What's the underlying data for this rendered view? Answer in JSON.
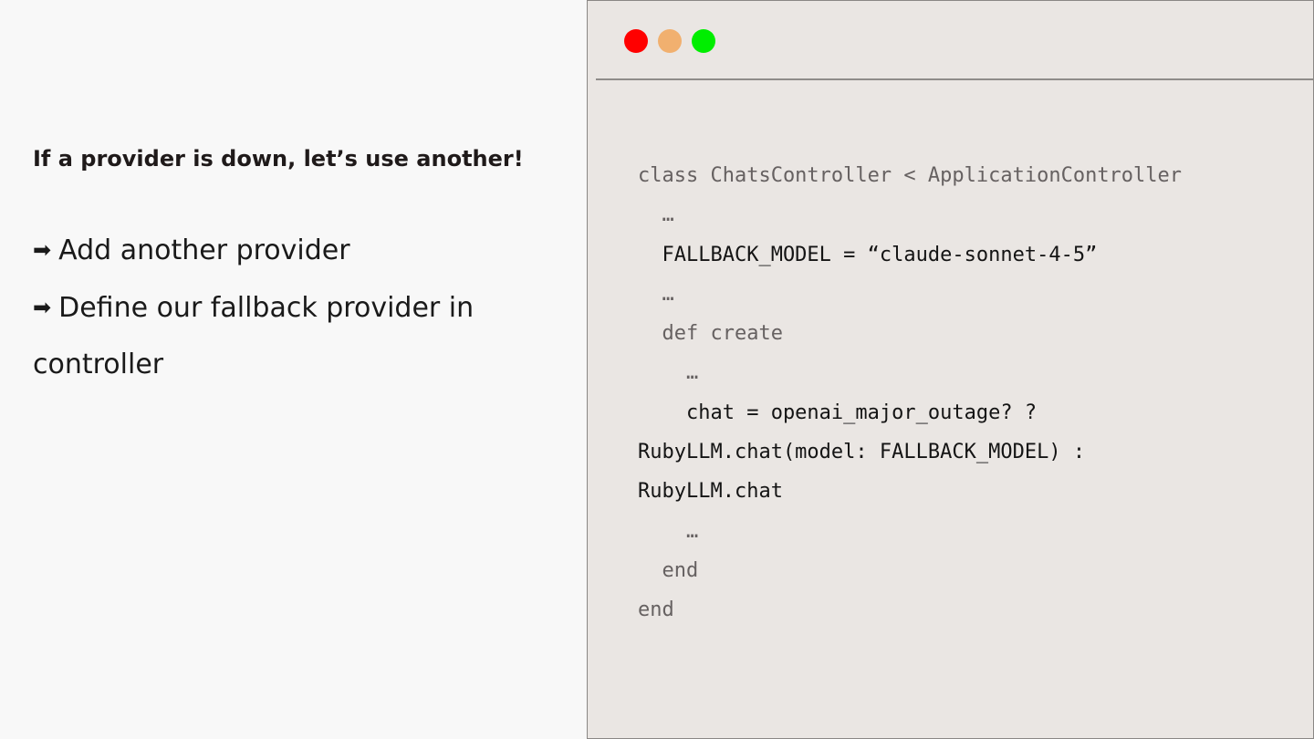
{
  "slide": {
    "heading": "If a provider is down, let’s use another!",
    "bullets": [
      {
        "arrow": "➡",
        "text": "Add another provider"
      },
      {
        "arrow": "➡",
        "text": "Define our fallback provider in controller"
      }
    ]
  },
  "code_window": {
    "traffic_lights": {
      "red": "#ff0000",
      "yellow": "#f1b06f",
      "green": "#00ee00"
    },
    "lines": [
      "class ChatsController < ApplicationController",
      "  …",
      "  FALLBACK_MODEL = “claude-sonnet-4-5”",
      "  …",
      "  def create",
      "    …",
      "    chat = openai_major_outage? ?",
      "RubyLLM.chat(model: FALLBACK_MODEL) :",
      "RubyLLM.chat",
      "    …",
      "  end",
      "end"
    ]
  }
}
